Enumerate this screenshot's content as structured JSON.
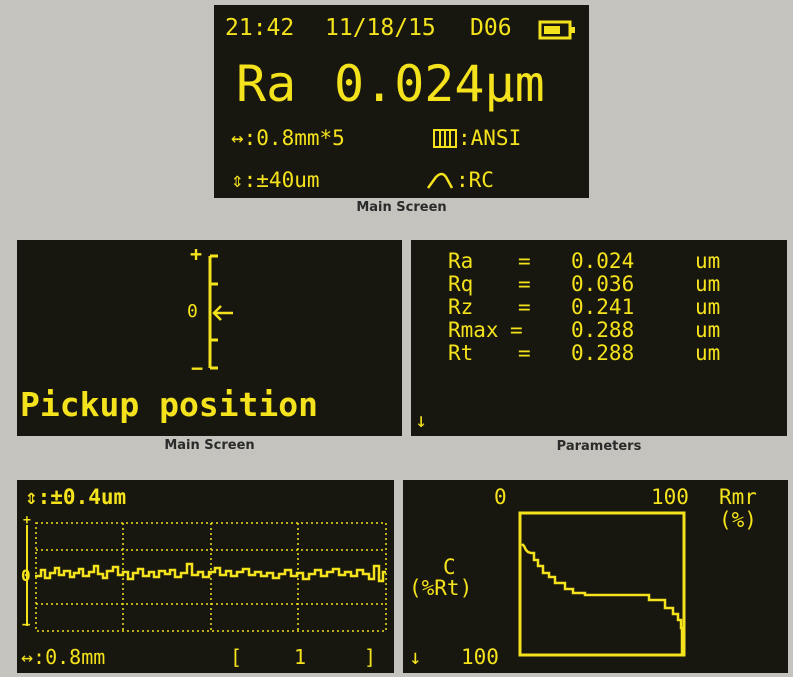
{
  "colors": {
    "lcd_background": "#17160f",
    "lcd_text": "#f4e21c",
    "page_background": "#c4c3bd"
  },
  "main_screen": {
    "time": "21:42",
    "date": "11/18/15",
    "data_id": "D06",
    "battery_icon": "battery-icon",
    "parameter": "Ra",
    "value": "0.024µm",
    "cutoff": "↔:0.8mm*5",
    "standard_icon": "standard-icon",
    "standard": ":ANSI",
    "range": "⇕:±40um",
    "filter_icon": "filter-icon",
    "filter": ":RC",
    "caption": "Main Screen"
  },
  "pickup_screen": {
    "plus": "+",
    "zero": "0",
    "minus": "−",
    "title": "Pickup position",
    "caption": "Main Screen"
  },
  "parameters_screen": {
    "rows": [
      {
        "name": "Ra",
        "eq": "=",
        "value": "0.024",
        "unit": "um"
      },
      {
        "name": "Rq",
        "eq": "=",
        "value": "0.036",
        "unit": "um"
      },
      {
        "name": "Rz",
        "eq": "=",
        "value": "0.241",
        "unit": "um"
      },
      {
        "name": "Rmax",
        "eq": "=",
        "value": "0.288",
        "unit": "um"
      },
      {
        "name": "Rt",
        "eq": "=",
        "value": "0.288",
        "unit": "um"
      }
    ],
    "arrow": "↓",
    "caption": "Parameters"
  },
  "profile_screen": {
    "range": "⇕:±0.4um",
    "plus": "+",
    "zero": "0",
    "minus": "−",
    "length": "↔:0.8mm",
    "bracket_left": "[",
    "page": "1",
    "bracket_right": "]"
  },
  "bearing_screen": {
    "x_start": "0",
    "x_end": "100",
    "x_label": "Rmr",
    "x_unit": "(%)",
    "y_label": "C",
    "y_unit": "(%Rt)",
    "arrow": "↓",
    "y_end": "100"
  }
}
